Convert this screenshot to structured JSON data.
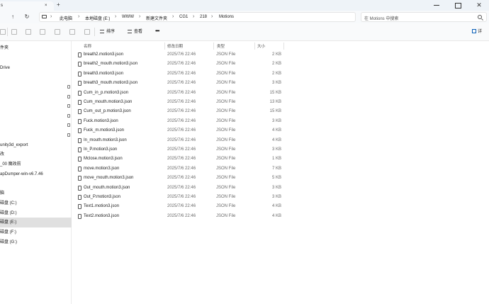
{
  "window": {
    "tab_label": "s",
    "tab_close": "×",
    "tab_add": "+",
    "close_glyph": "✕"
  },
  "nav": {
    "up_glyph": "↑",
    "refresh_glyph": "↻",
    "breadcrumb": [
      {
        "label": "此电脑",
        "name": "crumb-this-pc"
      },
      {
        "label": "本地磁盘 (E:)",
        "name": "crumb-local-disk-e"
      },
      {
        "label": "WWW",
        "name": "crumb-www"
      },
      {
        "label": "新建文件夹",
        "name": "crumb-new-folder"
      },
      {
        "label": "CG1",
        "name": "crumb-cg1"
      },
      {
        "label": "218",
        "name": "crumb-218"
      },
      {
        "label": "Motions",
        "name": "crumb-motions"
      }
    ],
    "sep_glyph": "›",
    "search_placeholder": "在 Motions 中搜索"
  },
  "toolbar": {
    "sort_label": "排序",
    "view_label": "查看",
    "more_glyph": "•••",
    "details_label": "详"
  },
  "sidebar": {
    "items": [
      {
        "label": "件夹",
        "name": "sidebar-item-folder"
      },
      {
        "label": "Drive",
        "name": "sidebar-item-drive"
      },
      {
        "label": "unity3d_export",
        "name": "sidebar-item-unity3d-export"
      },
      {
        "label": "改",
        "name": "sidebar-item-edit"
      },
      {
        "label": "_00 魔改前",
        "name": "sidebar-item-00-before-mod"
      },
      {
        "label": "apDumper-win-v6.7.46",
        "name": "sidebar-item-apdumper"
      },
      {
        "label": "脑",
        "name": "sidebar-item-pc"
      },
      {
        "label": "磁盘 (C:)",
        "name": "sidebar-item-disk-c"
      },
      {
        "label": "磁盘 (D:)",
        "name": "sidebar-item-disk-d"
      },
      {
        "label": "磁盘 (E:)",
        "name": "sidebar-item-disk-e"
      },
      {
        "label": "磁盘 (F:)",
        "name": "sidebar-item-disk-f"
      },
      {
        "label": "磁盘 (G:)",
        "name": "sidebar-item-disk-g"
      }
    ]
  },
  "columns": {
    "name": "名称",
    "date": "修改日期",
    "type": "类型",
    "size": "大小"
  },
  "files": [
    {
      "name": "breath2.motion3.json",
      "date": "2025/7/6 22:46",
      "type": "JSON File",
      "size": "2 KB"
    },
    {
      "name": "breath2_mouth.motion3.json",
      "date": "2025/7/6 22:46",
      "type": "JSON File",
      "size": "2 KB"
    },
    {
      "name": "breath3.motion3.json",
      "date": "2025/7/6 22:46",
      "type": "JSON File",
      "size": "2 KB"
    },
    {
      "name": "breath3_mouth.motion3.json",
      "date": "2025/7/6 22:46",
      "type": "JSON File",
      "size": "3 KB"
    },
    {
      "name": "Cum_in_p.motion3.json",
      "date": "2025/7/6 22:46",
      "type": "JSON File",
      "size": "15 KB"
    },
    {
      "name": "Cum_mouth.motion3.json",
      "date": "2025/7/6 22:46",
      "type": "JSON File",
      "size": "13 KB"
    },
    {
      "name": "Cum_out_p.motion3.json",
      "date": "2025/7/6 22:46",
      "type": "JSON File",
      "size": "15 KB"
    },
    {
      "name": "Fuck.motion3.json",
      "date": "2025/7/6 22:46",
      "type": "JSON File",
      "size": "3 KB"
    },
    {
      "name": "Fuck_m.motion3.json",
      "date": "2025/7/6 22:46",
      "type": "JSON File",
      "size": "4 KB"
    },
    {
      "name": "In_mouth.motion3.json",
      "date": "2025/7/6 22:46",
      "type": "JSON File",
      "size": "4 KB"
    },
    {
      "name": "In_P.motion3.json",
      "date": "2025/7/6 22:46",
      "type": "JSON File",
      "size": "3 KB"
    },
    {
      "name": "Mclose.motion3.json",
      "date": "2025/7/6 22:46",
      "type": "JSON File",
      "size": "1 KB"
    },
    {
      "name": "move.motion3.json",
      "date": "2025/7/6 22:46",
      "type": "JSON File",
      "size": "7 KB"
    },
    {
      "name": "move_mouth.motion3.json",
      "date": "2025/7/6 22:46",
      "type": "JSON File",
      "size": "5 KB"
    },
    {
      "name": "Out_mouth.motion3.json",
      "date": "2025/7/6 22:46",
      "type": "JSON File",
      "size": "3 KB"
    },
    {
      "name": "Out_P.motion3.json",
      "date": "2025/7/6 22:46",
      "type": "JSON File",
      "size": "3 KB"
    },
    {
      "name": "Text1.motion3.json",
      "date": "2025/7/6 22:46",
      "type": "JSON File",
      "size": "4 KB"
    },
    {
      "name": "Text2.motion3.json",
      "date": "2025/7/6 22:46",
      "type": "JSON File",
      "size": "4 KB"
    }
  ],
  "colors": {
    "accent": "#0a5fb8",
    "selection": "#e0e0e0"
  }
}
